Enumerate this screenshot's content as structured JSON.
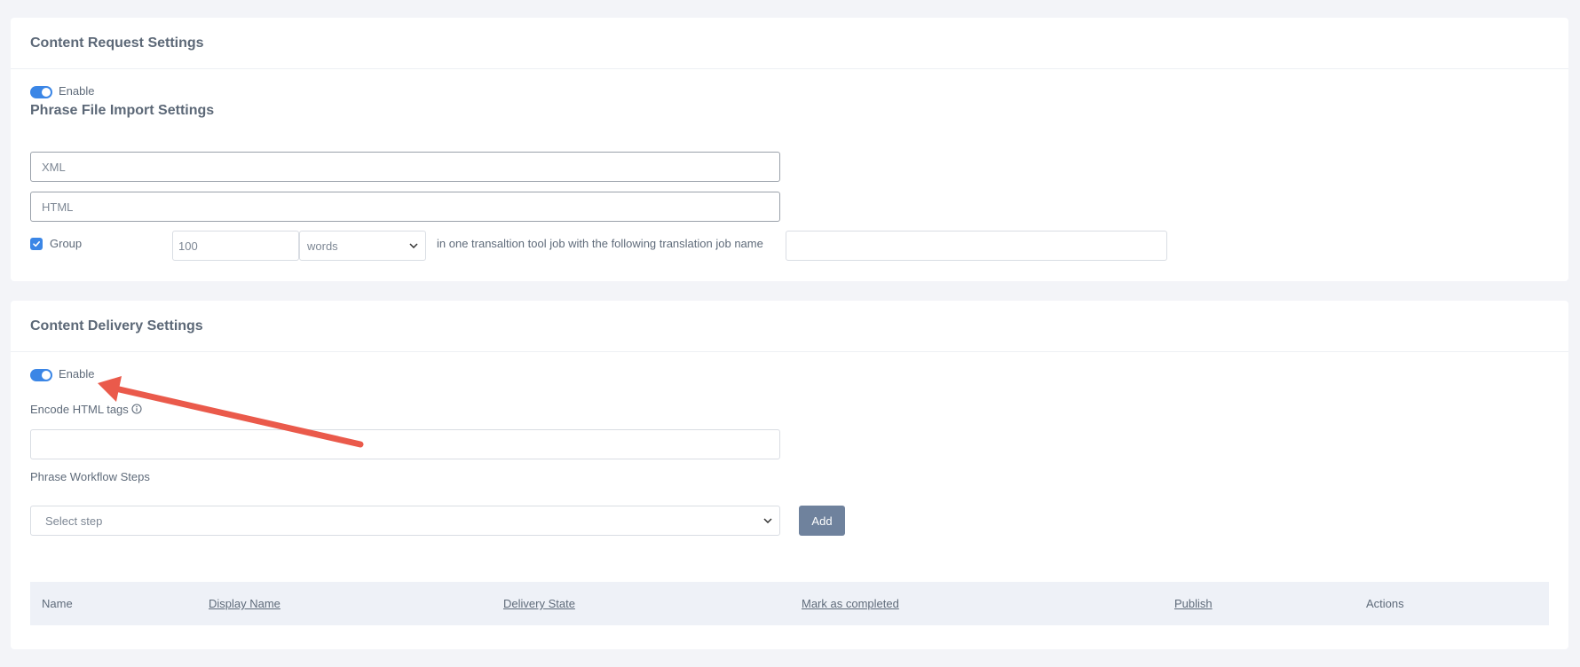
{
  "content_request": {
    "title": "Content Request Settings",
    "enable_label": "Enable",
    "import_heading": "Phrase File Import Settings",
    "xml_placeholder": "XML",
    "html_placeholder": "HTML",
    "group_label": "Group",
    "group_size": "100",
    "group_unit": "words",
    "group_text": "in one transaltion tool job with the following translation job name",
    "job_name_value": ""
  },
  "content_delivery": {
    "title": "Content Delivery Settings",
    "enable_label": "Enable",
    "encode_label": "Encode HTML tags",
    "encode_value": "",
    "workflow_label": "Phrase Workflow Steps",
    "select_placeholder": "Select step",
    "add_label": "Add",
    "table_columns": [
      "Name",
      "Display Name",
      "Delivery State",
      "Mark as completed",
      "Publish",
      "Actions"
    ]
  },
  "colors": {
    "accent": "#3b86e6",
    "annotation_arrow": "#ea5a4b",
    "button": "#6f829d"
  },
  "icons": {
    "info": "info-icon",
    "chevron": "chevron-down-icon",
    "check": "check-icon"
  }
}
